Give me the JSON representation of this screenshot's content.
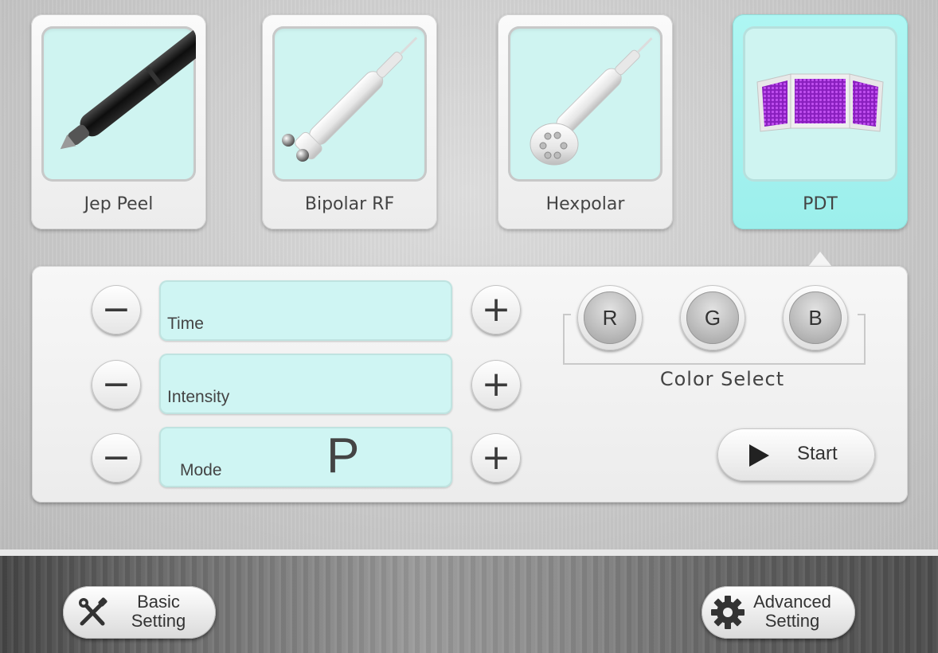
{
  "handpieces": [
    {
      "label": "Jep Peel",
      "active": false,
      "icon": "jet-peel-pen-icon"
    },
    {
      "label": "Bipolar RF",
      "active": false,
      "icon": "bipolar-rf-probe-icon"
    },
    {
      "label": "Hexpolar",
      "active": false,
      "icon": "hexpolar-probe-icon"
    },
    {
      "label": "PDT",
      "active": true,
      "icon": "pdt-led-panel-icon"
    }
  ],
  "controls": {
    "time": {
      "label": "Time",
      "value": ""
    },
    "intensity": {
      "label": "Intensity",
      "value": ""
    },
    "mode": {
      "label": "Mode",
      "value": "P"
    },
    "minus_symbol": "−",
    "plus_symbol": "+"
  },
  "color_select": {
    "label": "Color Select",
    "options": [
      "R",
      "G",
      "B"
    ]
  },
  "start": {
    "label": "Start",
    "icon": "play-icon"
  },
  "footer": {
    "basic_setting": {
      "line1": "Basic",
      "line2": "Setting",
      "icon": "tools-icon"
    },
    "advanced_setting": {
      "line1": "Advanced",
      "line2": "Setting",
      "icon": "gear-icon"
    }
  },
  "colors": {
    "active_card": "#a8f4f1",
    "display_bg": "#cff5f3",
    "pdt_led": "#9b2bd1"
  }
}
